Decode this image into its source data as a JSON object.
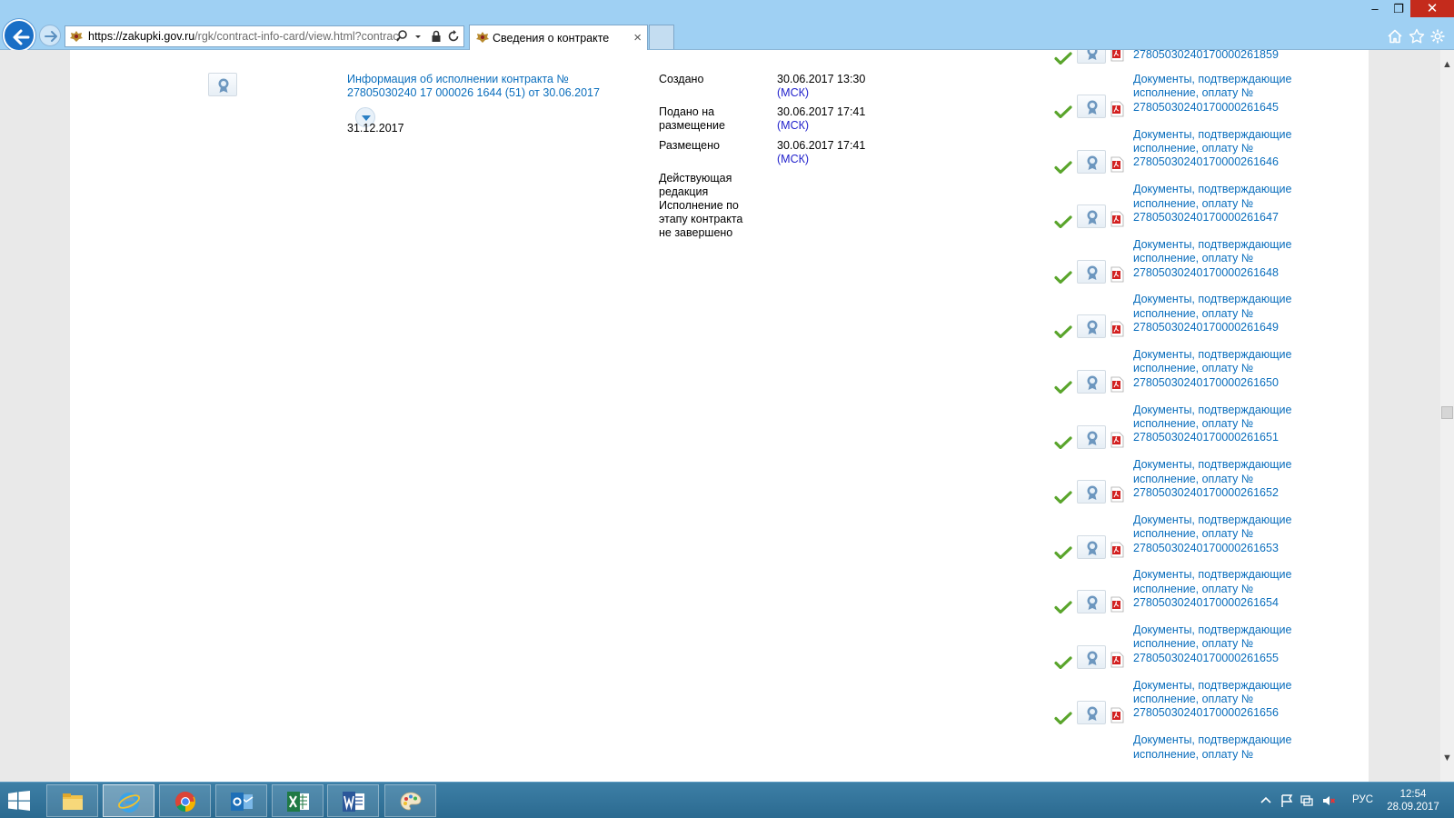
{
  "browser": {
    "url_domain": "https://zakupki.gov.ru",
    "url_path": "/rgk/contract-info-card/view.html?contrac",
    "tab_title": "Сведения о контракте",
    "tab_close": "×",
    "window_min": "–",
    "window_max": "❐",
    "window_close": "✕"
  },
  "record": {
    "title": "Информация об исполнении контракта № 27805030240 17 000026 1644 (51) от 30.06.2017",
    "end_date": "31.12.2017",
    "meta": [
      {
        "label": "Создано",
        "value": "30.06.2017 13:30",
        "tz": "(МСК)"
      },
      {
        "label": "Подано на размещение",
        "value": "30.06.2017 17:41",
        "tz": "(МСК)"
      },
      {
        "label": "Размещено",
        "value": "30.06.2017 17:41",
        "tz": "(МСК)"
      }
    ],
    "status": "Действующая редакция Исполнение по этапу контракта не завершено"
  },
  "documents": {
    "top_partial": "27805030240170000261859",
    "prefix": "Документы, подтверждающие исполнение, оплату №",
    "numbers": [
      "27805030240170000261645",
      "27805030240170000261646",
      "27805030240170000261647",
      "27805030240170000261648",
      "27805030240170000261649",
      "27805030240170000261650",
      "27805030240170000261651",
      "27805030240170000261652",
      "27805030240170000261653",
      "27805030240170000261654",
      "27805030240170000261655",
      "27805030240170000261656"
    ],
    "bottom_partial": "Документы, подтверждающие исполнение, оплату №"
  },
  "taskbar": {
    "apps": [
      "file-explorer",
      "internet-explorer",
      "chrome",
      "outlook",
      "excel",
      "word",
      "paint"
    ],
    "lang": "РУС",
    "time": "12:54",
    "date": "28.09.2017"
  },
  "colors": {
    "link": "#0a6ebd",
    "msk": "#2222cc",
    "chrome_bg": "#9fd0f3",
    "taskbar": "#2b6a90"
  }
}
